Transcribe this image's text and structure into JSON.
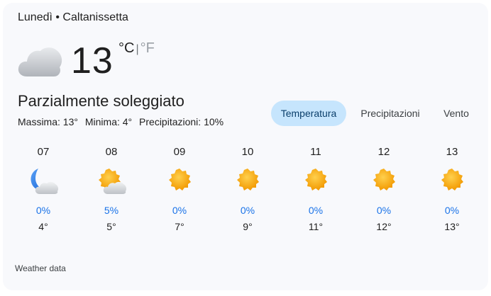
{
  "header": {
    "text": "Lunedì • Caltanissetta"
  },
  "current": {
    "icon": "cloudy-icon",
    "temperature": "13",
    "unit_c": "°C",
    "unit_separator": "|",
    "unit_f": "°F",
    "condition": "Parzialmente soleggiato",
    "max": "Massima: 13°",
    "min": "Minima: 4°",
    "precip": "Precipitazioni: 10%"
  },
  "tabs": [
    {
      "label": "Temperatura",
      "selected": true
    },
    {
      "label": "Precipitazioni",
      "selected": false
    },
    {
      "label": "Vento",
      "selected": false
    }
  ],
  "hourly": [
    {
      "time": "07",
      "icon": "moon-cloud-icon",
      "precip": "0%",
      "temp": "4°"
    },
    {
      "time": "08",
      "icon": "sun-cloud-icon",
      "precip": "5%",
      "temp": "5°"
    },
    {
      "time": "09",
      "icon": "sun-icon",
      "precip": "0%",
      "temp": "7°"
    },
    {
      "time": "10",
      "icon": "sun-icon",
      "precip": "0%",
      "temp": "9°"
    },
    {
      "time": "11",
      "icon": "sun-icon",
      "precip": "0%",
      "temp": "11°"
    },
    {
      "time": "12",
      "icon": "sun-icon",
      "precip": "0%",
      "temp": "12°"
    },
    {
      "time": "13",
      "icon": "sun-icon",
      "precip": "0%",
      "temp": "13°"
    }
  ],
  "footer": {
    "text": "Weather data"
  },
  "colors": {
    "accent": "#1a73e8",
    "tab_selected": "#c6e5fd",
    "sun": "#f9ab00"
  }
}
